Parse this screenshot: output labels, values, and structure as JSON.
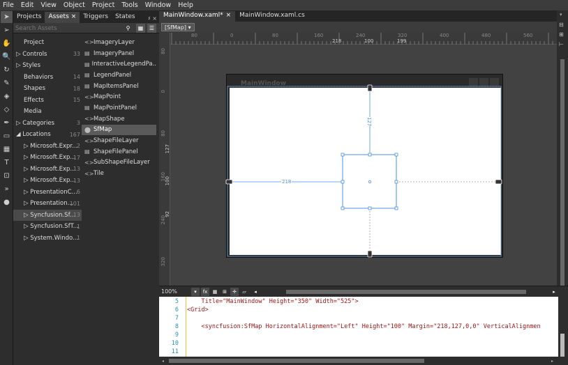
{
  "menu": [
    "File",
    "Edit",
    "View",
    "Object",
    "Project",
    "Tools",
    "Window",
    "Help"
  ],
  "asset_panel": {
    "tabs": [
      {
        "label": "Projects",
        "active": false
      },
      {
        "label": "Assets",
        "active": true,
        "close": "×"
      },
      {
        "label": "Triggers",
        "active": false
      },
      {
        "label": "States",
        "active": false
      }
    ],
    "pin": "♯ ×",
    "search_placeholder": "Search Assets",
    "categories": [
      {
        "label": "Project",
        "count": "",
        "indent": 1
      },
      {
        "label": "▷ Controls",
        "count": "33",
        "indent": 0
      },
      {
        "label": "▷ Styles",
        "count": "",
        "indent": 0
      },
      {
        "label": "Behaviors",
        "count": "14",
        "indent": 1
      },
      {
        "label": "Shapes",
        "count": "18",
        "indent": 1
      },
      {
        "label": "Effects",
        "count": "15",
        "indent": 1
      },
      {
        "label": "Media",
        "count": "",
        "indent": 1
      },
      {
        "label": "▷ Categories",
        "count": "3",
        "indent": 0
      },
      {
        "label": "◢ Locations",
        "count": "167",
        "indent": 0
      },
      {
        "label": "▷ Microsoft.Expr...",
        "count": "2",
        "indent": 1
      },
      {
        "label": "▷ Microsoft.Exp...",
        "count": "17",
        "indent": 1
      },
      {
        "label": "▷ Microsoft.Exp...",
        "count": "13",
        "indent": 1
      },
      {
        "label": "▷ Microsoft.Exp...",
        "count": "13",
        "indent": 1
      },
      {
        "label": "▷ PresentationC...",
        "count": "6",
        "indent": 1
      },
      {
        "label": "▷ Presentation...",
        "count": "101",
        "indent": 1
      },
      {
        "label": "▷ Syncfusion.Sf...",
        "count": "13",
        "indent": 1,
        "selected": true
      },
      {
        "label": "▷ Syncfusion.SfT...",
        "count": "1",
        "indent": 1
      },
      {
        "label": "▷ System.Windo...",
        "count": "1",
        "indent": 1
      }
    ],
    "items": [
      {
        "icon": "<>",
        "label": "ImageryLayer"
      },
      {
        "icon": "▤",
        "label": "ImageryPanel"
      },
      {
        "icon": "▤",
        "label": "InteractiveLegendPa..."
      },
      {
        "icon": "▤",
        "label": "LegendPanel"
      },
      {
        "icon": "▤",
        "label": "MapItemsPanel"
      },
      {
        "icon": "<>",
        "label": "MapPoint"
      },
      {
        "icon": "▤",
        "label": "MapPointPanel"
      },
      {
        "icon": "<>",
        "label": "MapShape"
      },
      {
        "icon": "⬤",
        "label": "SfMap",
        "selected": true
      },
      {
        "icon": "<>",
        "label": "ShapeFileLayer"
      },
      {
        "icon": "▤",
        "label": "ShapeFilePanel"
      },
      {
        "icon": "<>",
        "label": "SubShapeFileLayer"
      },
      {
        "icon": "<>",
        "label": "Tile"
      }
    ]
  },
  "doc_tabs": [
    {
      "label": "MainWindow.xaml*",
      "close": "×",
      "active": true
    },
    {
      "label": "MainWindow.xaml.cs",
      "active": false
    }
  ],
  "breadcrumb": "[SfMap] ▾",
  "hruler": {
    "labels": [
      "80",
      "0",
      "80",
      "160",
      "240",
      "320",
      "400",
      "480",
      "560"
    ],
    "readouts": [
      "218",
      "100",
      "199"
    ]
  },
  "vruler": {
    "labels": [
      "80",
      "0",
      "80",
      "127",
      "160",
      "100",
      "240",
      "92",
      "320"
    ]
  },
  "design": {
    "window_title": "MainWindow",
    "left_margin": "218",
    "top_margin": "127"
  },
  "zoom": "100%",
  "code_lines": [
    {
      "n": "5",
      "text": "    Title=\"MainWindow\" Height=\"350\" Width=\"525\">"
    },
    {
      "n": "6",
      "text": "<Grid>"
    },
    {
      "n": "7",
      "text": ""
    },
    {
      "n": "8",
      "text": "    <syncfusion:SfMap HorizontalAlignment=\"Left\" Height=\"100\" Margin=\"218,127,0,0\" VerticalAlignmen"
    },
    {
      "n": "9",
      "text": ""
    },
    {
      "n": "10",
      "text": ""
    },
    {
      "n": "11",
      "text": ""
    }
  ],
  "colors": {
    "accent": "#4a90e2",
    "code_attr": "#ff0000",
    "code_value": "#0000ff",
    "code_tag": "#a31515"
  }
}
